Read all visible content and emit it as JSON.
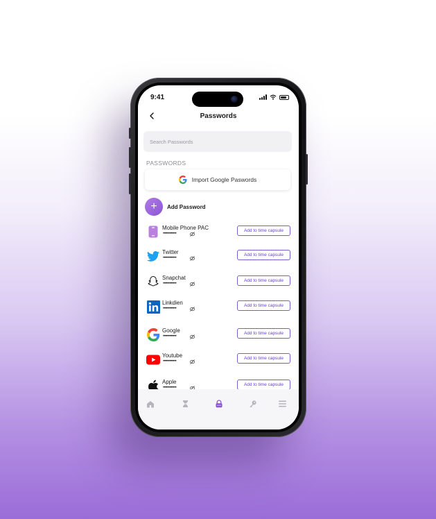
{
  "status": {
    "time": "9:41"
  },
  "header": {
    "title": "Passwords",
    "back_icon": "chevron-left-icon"
  },
  "search": {
    "placeholder": "Search Passwords"
  },
  "section": {
    "label": "PASSWORDS"
  },
  "import": {
    "label": "Import Google Paswords",
    "icon": "google-icon"
  },
  "add": {
    "label": "Add Password",
    "icon": "plus-icon"
  },
  "passwords": [
    {
      "name": "Mobile Phone PAC",
      "masked": "••••••••••••",
      "icon": "phone-icon",
      "action": "Add to time capsule"
    },
    {
      "name": "Twitter",
      "masked": "••••••••••••",
      "icon": "twitter-icon",
      "action": "Add to time capsule"
    },
    {
      "name": "Snapchat",
      "masked": "••••••••••••",
      "icon": "snapchat-icon",
      "action": "Add to time capsule"
    },
    {
      "name": "Linkdien",
      "masked": "••••••••••••",
      "icon": "linkedin-icon",
      "action": "Add to time capsule"
    },
    {
      "name": "Google",
      "masked": "••••••••••••",
      "icon": "google-icon",
      "action": "Add to time capsule"
    },
    {
      "name": "Youtube",
      "masked": "••••••••••••",
      "icon": "youtube-icon",
      "action": "Add to time capsule"
    },
    {
      "name": "Apple",
      "masked": "••••••••••••",
      "icon": "apple-icon",
      "action": "Add to time capsule"
    }
  ],
  "tabs": [
    {
      "icon": "home-icon",
      "active": false
    },
    {
      "icon": "hourglass-icon",
      "active": false
    },
    {
      "icon": "lock-icon",
      "active": true
    },
    {
      "icon": "key-icon",
      "active": false
    },
    {
      "icon": "menu-icon",
      "active": false
    }
  ],
  "colors": {
    "accent": "#8b55d6",
    "button_border": "#7d5ad1",
    "inactive_tab": "#b5b5bb"
  }
}
